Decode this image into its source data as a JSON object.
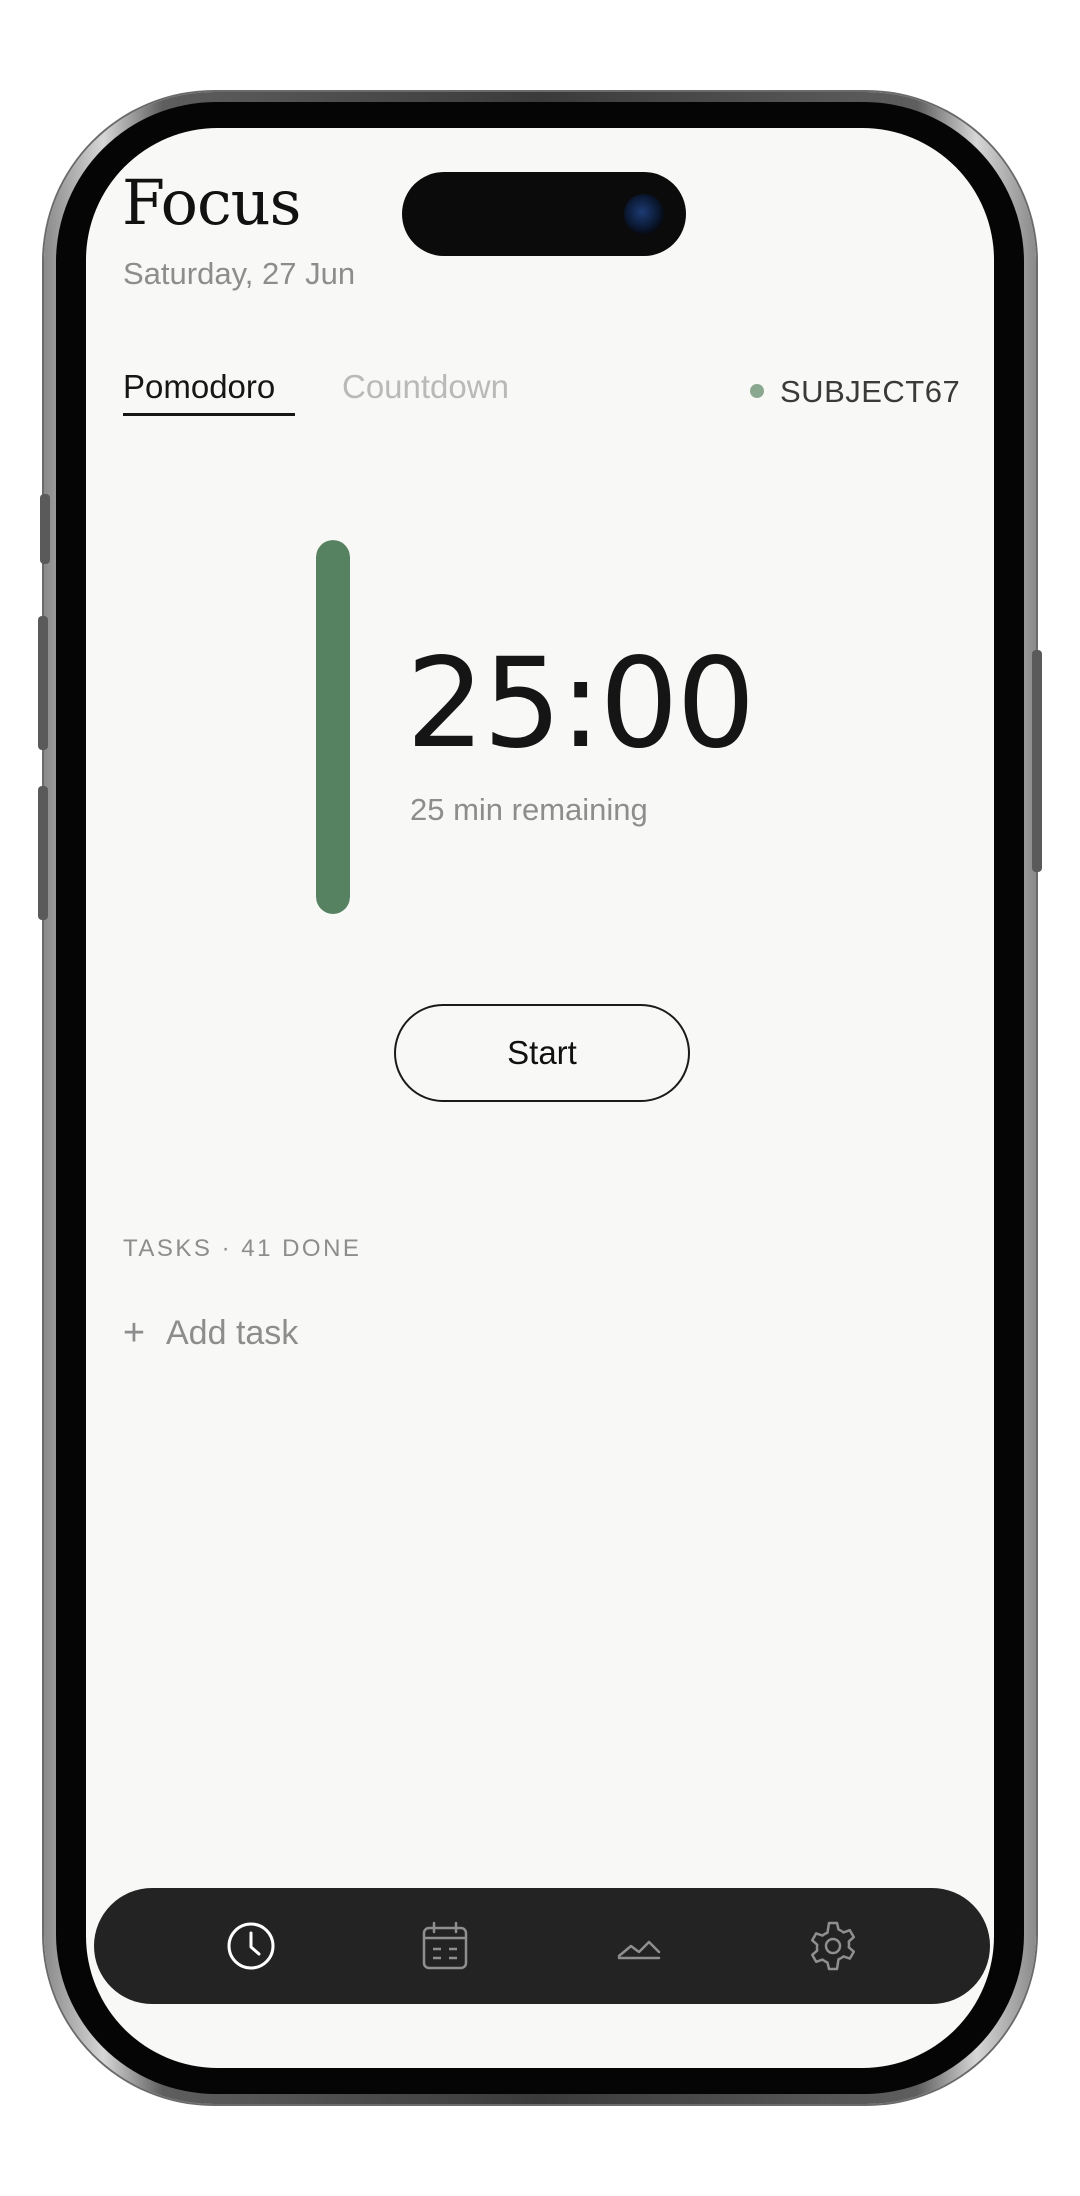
{
  "header": {
    "title": "Focus",
    "date": "Saturday, 27 Jun"
  },
  "mode_tabs": [
    {
      "label": "Pomodoro",
      "selected": true
    },
    {
      "label": "Countdown",
      "selected": false
    }
  ],
  "subject": {
    "label": "SUBJECT67",
    "dot_color": "#8aa78f"
  },
  "timer": {
    "display": "25:00",
    "remaining_text": "25 min remaining",
    "progress_fraction": 1.0,
    "accent_color": "#578262"
  },
  "actions": {
    "start_label": "Start"
  },
  "tasks": {
    "header": "TASKS · 41 DONE",
    "add_plus": "+",
    "add_label": "Add task",
    "items": []
  },
  "bottom_nav": [
    {
      "icon": "clock-icon",
      "active": true
    },
    {
      "icon": "calendar-icon",
      "active": false
    },
    {
      "icon": "chart-icon",
      "active": false
    },
    {
      "icon": "gear-icon",
      "active": false
    }
  ]
}
